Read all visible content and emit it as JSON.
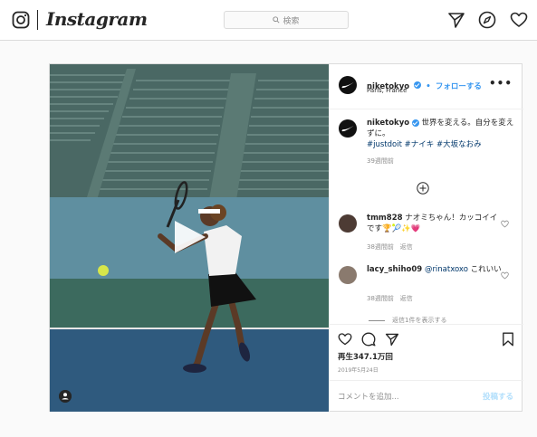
{
  "topbar": {
    "logo_text": "Instagram",
    "search_placeholder": "検索",
    "icons": [
      "instagram-logo-icon",
      "search-icon",
      "direct-message-icon",
      "explore-compass-icon",
      "activity-heart-icon"
    ]
  },
  "post": {
    "author": {
      "username": "niketokyo",
      "verified": true,
      "follow_label": "フォローする",
      "separator": "•",
      "location": "Paris, France"
    },
    "caption": {
      "username": "niketokyo",
      "text": "世界を変える。自分を変えずに。",
      "hashtags": "#justdoit #ナイキ #大坂なおみ",
      "age": "39週間前"
    },
    "comments": [
      {
        "username": "tmm828",
        "text": "ナオミちゃん！カッコイイです🏆🎾✨💗",
        "age": "38週間前",
        "reply_label": "返信"
      },
      {
        "username": "lacy_shiho09",
        "mention": "@rinatxoxo",
        "text": "これいい",
        "age": "38週間前",
        "reply_label": "返信",
        "view_replies": "返信1件を表示する"
      }
    ],
    "views": "再生347.1万回",
    "date": "2019年5月24日",
    "add_comment_placeholder": "コメントを追加...",
    "post_button": "投稿する"
  },
  "colors": {
    "link_blue": "#3897f0",
    "hashtag_blue": "#00376b",
    "border": "#dbdbdb",
    "muted": "#8e8e8e"
  }
}
